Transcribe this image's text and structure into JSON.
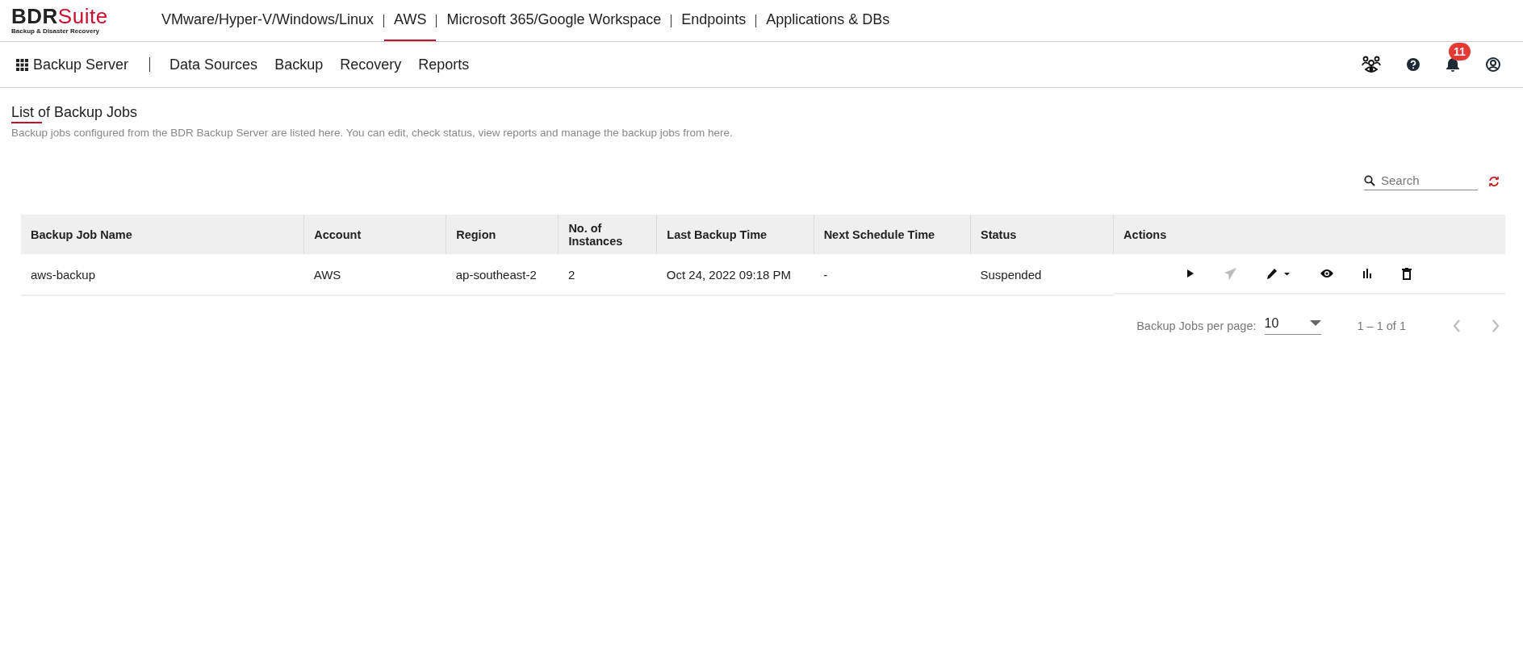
{
  "brand": {
    "name_a": "BDR",
    "name_b": "Suite",
    "tagline": "Backup & Disaster Recovery"
  },
  "top_nav": [
    {
      "label": "VMware/Hyper-V/Windows/Linux",
      "selected": false
    },
    {
      "label": "AWS",
      "selected": true
    },
    {
      "label": "Microsoft 365/Google Workspace",
      "selected": false
    },
    {
      "label": "Endpoints",
      "selected": false
    },
    {
      "label": "Applications & DBs",
      "selected": false
    }
  ],
  "sub_nav": {
    "server": "Backup Server",
    "items": [
      "Data Sources",
      "Backup",
      "Recovery",
      "Reports"
    ],
    "notification_count": "11"
  },
  "page": {
    "title": "List of Backup Jobs",
    "description": "Backup jobs configured from the BDR Backup Server are listed here. You can edit, check status, view reports and manage the backup jobs from here."
  },
  "search": {
    "placeholder": "Search"
  },
  "table": {
    "columns": [
      "Backup Job Name",
      "Account",
      "Region",
      "No. of Instances",
      "Last Backup Time",
      "Next Schedule Time",
      "Status",
      "Actions"
    ],
    "rows": [
      {
        "cells": [
          "aws-backup",
          "AWS",
          "ap-southeast-2",
          "2",
          "Oct 24, 2022 09:18 PM",
          "-",
          "Suspended"
        ],
        "actions": [
          {
            "kind": "run",
            "disabled": false
          },
          {
            "kind": "send",
            "disabled": true
          },
          {
            "kind": "edit",
            "disabled": false
          },
          {
            "kind": "view",
            "disabled": false
          },
          {
            "kind": "report",
            "disabled": false
          },
          {
            "kind": "delete",
            "disabled": false
          }
        ]
      }
    ]
  },
  "pagination": {
    "label": "Backup Jobs per page:",
    "per_page": "10",
    "range": "1 – 1 of 1"
  }
}
